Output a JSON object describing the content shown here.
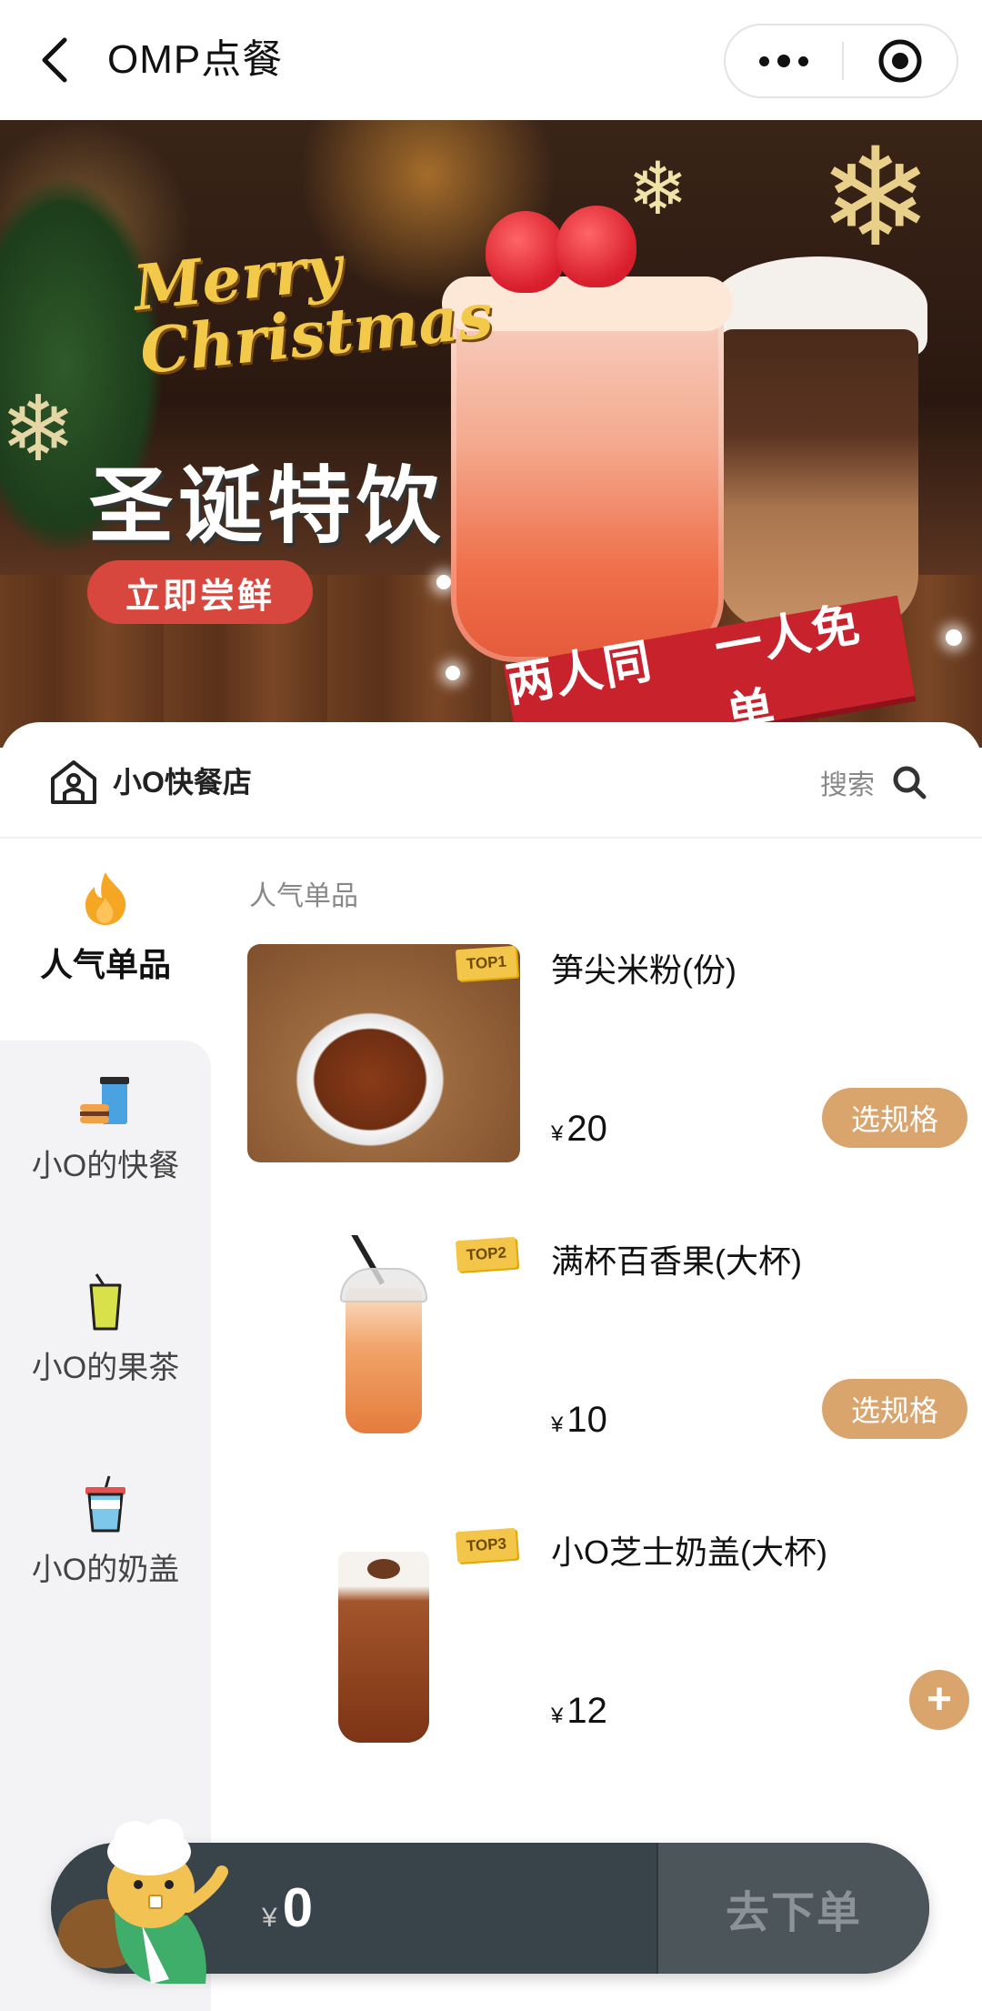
{
  "nav": {
    "title": "OMP点餐",
    "back_icon": "chevron-left-icon",
    "more_icon": "more-dots-icon",
    "close_icon": "target-close-icon"
  },
  "banner": {
    "script_text": "Merry Christmas",
    "headline": "圣诞特饮",
    "cta": "立即尝鲜",
    "ribbon_left": "两人同行",
    "ribbon_right": "一人免单"
  },
  "store": {
    "name": "小O快餐店",
    "icon": "store-icon",
    "search_label": "搜索",
    "search_icon": "search-icon"
  },
  "categories": [
    {
      "label": "人气单品",
      "icon": "flame-icon",
      "active": true
    },
    {
      "label": "小O的快餐",
      "icon": "burger-drink-icon",
      "active": false
    },
    {
      "label": "小O的果茶",
      "icon": "fruit-tea-icon",
      "active": false
    },
    {
      "label": "小O的奶盖",
      "icon": "milk-cap-icon",
      "active": false
    }
  ],
  "section": {
    "title": "人气单品"
  },
  "products": [
    {
      "badge": "TOP1",
      "name": "笋尖米粉(份)",
      "currency": "¥",
      "price": "20",
      "action": "选规格"
    },
    {
      "badge": "TOP2",
      "name": "满杯百香果(大杯)",
      "currency": "¥",
      "price": "10",
      "action": "选规格"
    },
    {
      "badge": "TOP3",
      "name": "小O芝士奶盖(大杯)",
      "currency": "¥",
      "price": "12",
      "action": "+"
    }
  ],
  "cart": {
    "currency": "¥",
    "total": "0",
    "checkout": "去下单",
    "mascot_icon": "beaver-chef-mascot"
  },
  "colors": {
    "accent": "#d9a56d",
    "cart_bg": "#39444a",
    "banner_cta": "#d8473d",
    "badge": "#f3c64a",
    "flame": "#f5a623"
  }
}
